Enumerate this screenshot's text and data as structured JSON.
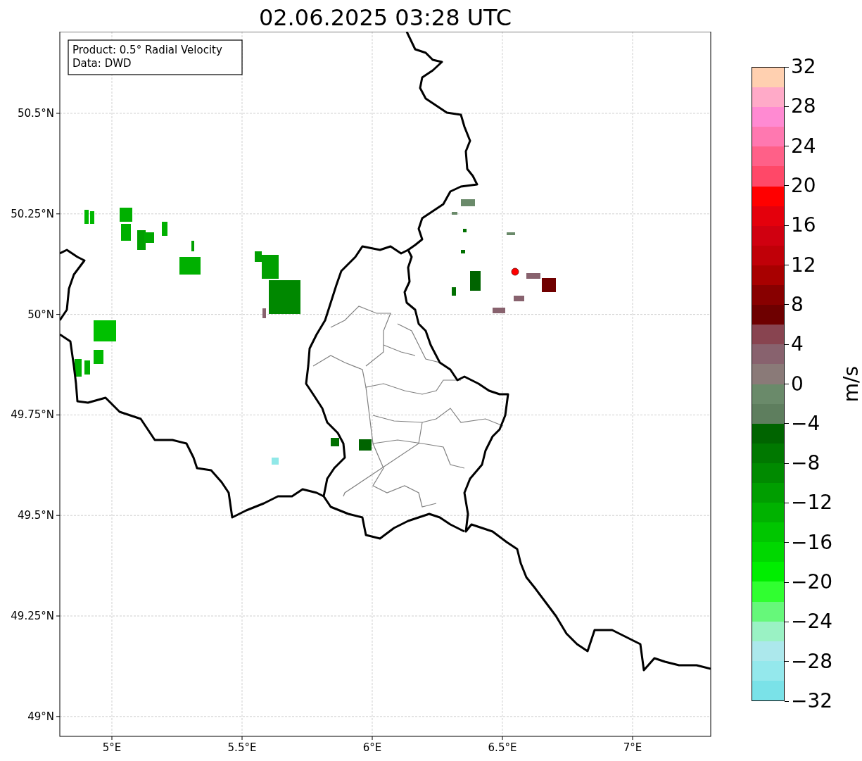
{
  "title": "02.06.2025 03:28 UTC",
  "info_box": {
    "lines": [
      "Product: 0.5° Radial Velocity",
      "Data: DWD"
    ]
  },
  "map": {
    "yticks": [
      "50.5°N",
      "50.25°N",
      "50°N",
      "49.75°N",
      "49.5°N",
      "49.25°N",
      "49°N"
    ],
    "xticks": [
      "5°E",
      "5.5°E",
      "6°E",
      "6.5°E",
      "7°E"
    ]
  },
  "colorbar": {
    "label": "m/s",
    "ticks": [
      "32",
      "28",
      "24",
      "20",
      "16",
      "12",
      "8",
      "4",
      "0",
      "−4",
      "−8",
      "−12",
      "−16",
      "−20",
      "−24",
      "−28",
      "−32"
    ],
    "segments": [
      {
        "color": "#ffd0b0"
      },
      {
        "color": "#ffaac8"
      },
      {
        "color": "#ff8ad2"
      },
      {
        "color": "#ff78b0"
      },
      {
        "color": "#ff6088"
      },
      {
        "color": "#ff4868"
      },
      {
        "color": "#ff0000"
      },
      {
        "color": "#e4000c"
      },
      {
        "color": "#d00010"
      },
      {
        "color": "#c00008"
      },
      {
        "color": "#a80000"
      },
      {
        "color": "#880000"
      },
      {
        "color": "#6e0000"
      },
      {
        "color": "#884450"
      },
      {
        "color": "#88626e"
      },
      {
        "color": "#8a7a78"
      },
      {
        "color": "#6a8a6a"
      },
      {
        "color": "#5e7e5e"
      },
      {
        "color": "#006400"
      },
      {
        "color": "#007800"
      },
      {
        "color": "#008a00"
      },
      {
        "color": "#009e00"
      },
      {
        "color": "#00b200"
      },
      {
        "color": "#00c600"
      },
      {
        "color": "#00d800"
      },
      {
        "color": "#00ee00"
      },
      {
        "color": "#30ff30"
      },
      {
        "color": "#66f87a"
      },
      {
        "color": "#9af2c4"
      },
      {
        "color": "#ace8ec"
      },
      {
        "color": "#94e8ec"
      },
      {
        "color": "#7ae2e8"
      }
    ]
  }
}
